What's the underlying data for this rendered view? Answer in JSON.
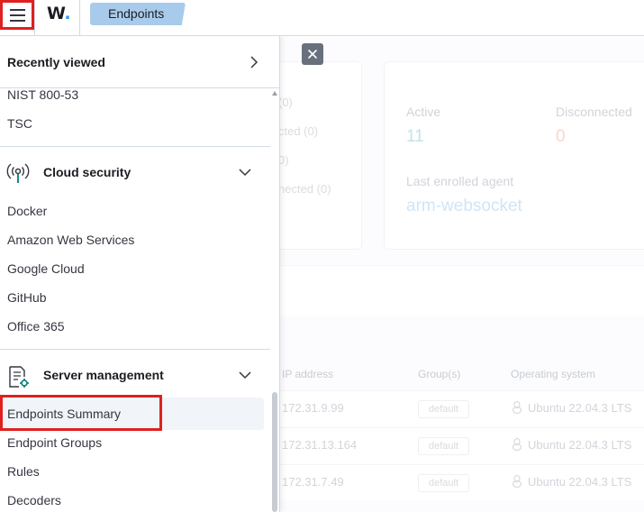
{
  "header": {
    "logo_text": "W",
    "logo_dot": ".",
    "breadcrumb": "Endpoints"
  },
  "background": {
    "status_lines": [
      "(0)",
      "cted (0)",
      "0)",
      "nected (0)"
    ],
    "active_label": "Active",
    "active_value": "11",
    "disconnected_label": "Disconnected",
    "disconnected_value": "0",
    "last_enrolled_label": "Last enrolled agent",
    "last_enrolled_value": "arm-websocket",
    "columns": [
      "IP address",
      "Group(s)",
      "Operating system"
    ],
    "rows": [
      {
        "ip": "172.31.9.99",
        "group": "default",
        "os": "Ubuntu 22.04.3 LTS"
      },
      {
        "ip": "172.31.13.164",
        "group": "default",
        "os": "Ubuntu 22.04.3 LTS"
      },
      {
        "ip": "172.31.7.49",
        "group": "default",
        "os": "Ubuntu 22.04.3 LTS"
      }
    ],
    "colors": {
      "active": "#00bfb3",
      "disconnected": "#e7664c",
      "link": "#3595f9"
    }
  },
  "sidenav": {
    "recent_label": "Recently viewed",
    "top_items": [
      "NIST 800-53",
      "TSC"
    ],
    "cloud_title": "Cloud security",
    "cloud_items": [
      "Docker",
      "Amazon Web Services",
      "Google Cloud",
      "GitHub",
      "Office 365"
    ],
    "server_title": "Server management",
    "server_items": [
      "Endpoints Summary",
      "Endpoint Groups",
      "Rules",
      "Decoders"
    ],
    "icons": {
      "recent": "chevron-right-icon",
      "cloud": "antenna-icon",
      "server": "document-gear-icon",
      "group_toggle": "chevron-down-icon"
    },
    "highlight_color": "#e0201e"
  }
}
